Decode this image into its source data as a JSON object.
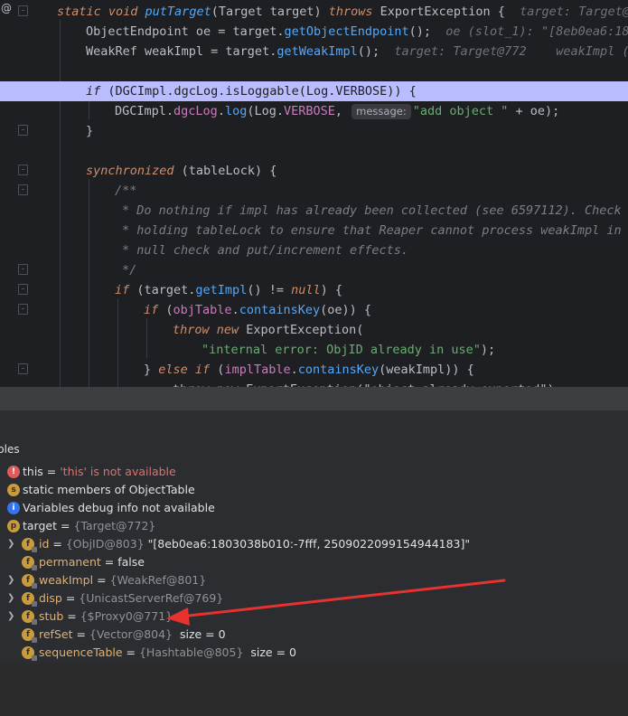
{
  "editor": {
    "lines": [
      {
        "l1a": "static void ",
        "l1b": "putTarget",
        "l1c": "(Target target) ",
        "l1d": "throws ",
        "l1e": "ExportException {",
        "hint": "target: Target@"
      },
      {
        "l2a": "ObjectEndpoint oe = target.",
        "l2b": "getObjectEndpoint",
        "l2c": "();",
        "hint": "oe (slot_1): \"[8eb0ea6:180"
      },
      {
        "l3a": "WeakRef weakImpl = target.",
        "l3b": "getWeakImpl",
        "l3c": "();",
        "hint": "target: Target@772    weakImpl (s"
      },
      {
        "l4a": "if ",
        "l4b": "(DGCImpl.dgcLog.isLoggable(Log.VERBOSE)) {"
      },
      {
        "l5a": "DGCImpl.",
        "l5b": "dgcLog",
        "l5c": ".",
        "l5d": "log",
        "l5e": "(Log.",
        "l5f": "VERBOSE",
        "l5g": ", ",
        "hint_label": "message:",
        "l5h": "\"add object \" ",
        "l5i": "+ oe);"
      },
      {
        "l6": "}"
      },
      {
        "l7a": "synchronized ",
        "l7b": "(tableLock) {"
      },
      {
        "c1": "/**"
      },
      {
        "c2": "* Do nothing if impl has already been collected (see 6597112). Check w"
      },
      {
        "c3": "* holding tableLock to ensure that Reaper cannot process weakImpl in b"
      },
      {
        "c4": "* null check and put/increment effects."
      },
      {
        "c5": "*/"
      },
      {
        "l8a": "if ",
        "l8b": "(target.",
        "l8c": "getImpl",
        "l8d": "() != ",
        "l8e": "null",
        "l8f": ") {"
      },
      {
        "l9a": "if ",
        "l9b": "(",
        "l9c": "objTable",
        "l9d": ".",
        "l9e": "containsKey",
        "l9f": "(oe)) {"
      },
      {
        "l10a": "throw new ",
        "l10b": "ExportException("
      },
      {
        "l11": "\"internal error: ObjID already in use\"",
        "l11b": ");"
      },
      {
        "l12a": "} ",
        "l12b": "else if ",
        "l12c": "(",
        "l12d": "implTable",
        "l12e": ".",
        "l12f": "containsKey",
        "l12g": "(weakImpl)) {"
      },
      {
        "l13": "throw new ExportException(\"object already exported\");"
      }
    ]
  },
  "panel": {
    "title": "bles"
  },
  "variables": [
    {
      "name": "this",
      "eq": " = ",
      "value": "'this' is not available"
    },
    {
      "name": "static",
      "value": " members of ObjectTable"
    },
    {
      "value": "Variables debug info not available"
    },
    {
      "name": "target",
      "eq": " = ",
      "type": "{Target@772}"
    },
    {
      "name": "id",
      "eq": " = ",
      "type": "{ObjID@803} ",
      "value": "\"[8eb0ea6:1803038b010:-7fff, 2509022099154944183]\""
    },
    {
      "name": "permanent",
      "eq": " = ",
      "value": "false"
    },
    {
      "name": "weakImpl",
      "eq": " = ",
      "type": "{WeakRef@801}"
    },
    {
      "name": "disp",
      "eq": " = ",
      "type": "{UnicastServerRef@769}"
    },
    {
      "name": "stub",
      "eq": " = ",
      "type": "{$Proxy0@771}"
    },
    {
      "name": "refSet",
      "eq": " = ",
      "type": "{Vector@804} ",
      "value": " size = 0"
    },
    {
      "name": "sequenceTable",
      "eq": " = ",
      "type": "{Hashtable@805} ",
      "value": " size = 0"
    }
  ],
  "icons": {
    "error": "error-icon",
    "static": "static-icon",
    "info": "info-icon",
    "param": "parameter-icon",
    "field": "field-icon"
  },
  "colors": {
    "highlight_line": "#b9bcfe",
    "annotation_arrow": "#e8322f"
  }
}
